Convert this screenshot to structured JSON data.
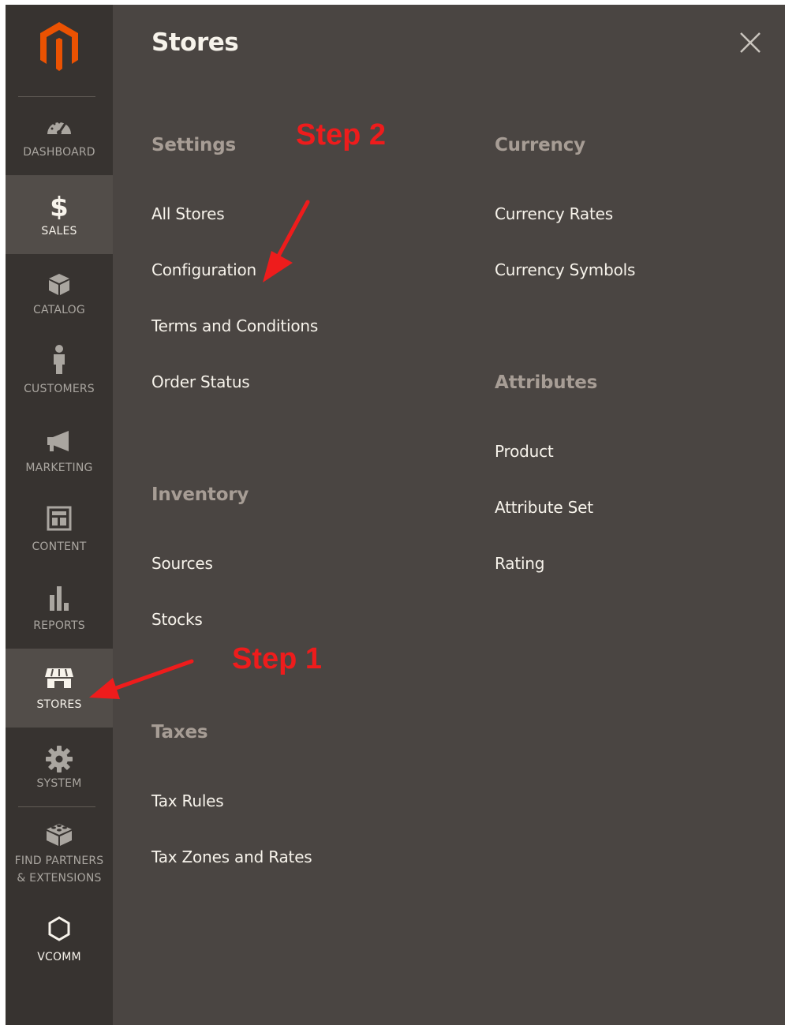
{
  "sidebar": {
    "items": [
      {
        "label": "DASHBOARD",
        "icon": "gauge-icon"
      },
      {
        "label": "SALES",
        "icon": "dollar-icon"
      },
      {
        "label": "CATALOG",
        "icon": "box-icon"
      },
      {
        "label": "CUSTOMERS",
        "icon": "person-icon"
      },
      {
        "label": "MARKETING",
        "icon": "megaphone-icon"
      },
      {
        "label": "CONTENT",
        "icon": "layout-icon"
      },
      {
        "label": "REPORTS",
        "icon": "bar-chart-icon"
      },
      {
        "label": "STORES",
        "icon": "storefront-icon"
      },
      {
        "label": "SYSTEM",
        "icon": "gear-icon"
      },
      {
        "label_line1": "FIND PARTNERS",
        "label_line2": "& EXTENSIONS",
        "icon": "blocks-icon"
      },
      {
        "label": "VCOMM",
        "icon": "hexagon-icon"
      }
    ]
  },
  "panel": {
    "title": "Stores",
    "close_icon": "close-icon",
    "sections": {
      "settings": {
        "title": "Settings",
        "links": [
          "All Stores",
          "Configuration",
          "Terms and Conditions",
          "Order Status"
        ]
      },
      "inventory": {
        "title": "Inventory",
        "links": [
          "Sources",
          "Stocks"
        ]
      },
      "taxes": {
        "title": "Taxes",
        "links": [
          "Tax Rules",
          "Tax Zones and Rates"
        ]
      },
      "currency": {
        "title": "Currency",
        "links": [
          "Currency Rates",
          "Currency Symbols"
        ]
      },
      "attributes": {
        "title": "Attributes",
        "links": [
          "Product",
          "Attribute Set",
          "Rating"
        ]
      }
    }
  },
  "annotations": {
    "step1": "Step 1",
    "step2": "Step 2",
    "color": "#ee1c1c"
  },
  "colors": {
    "sidebar_bg": "#373330",
    "panel_bg": "#4a4542",
    "logo_orange": "#eb5202"
  }
}
